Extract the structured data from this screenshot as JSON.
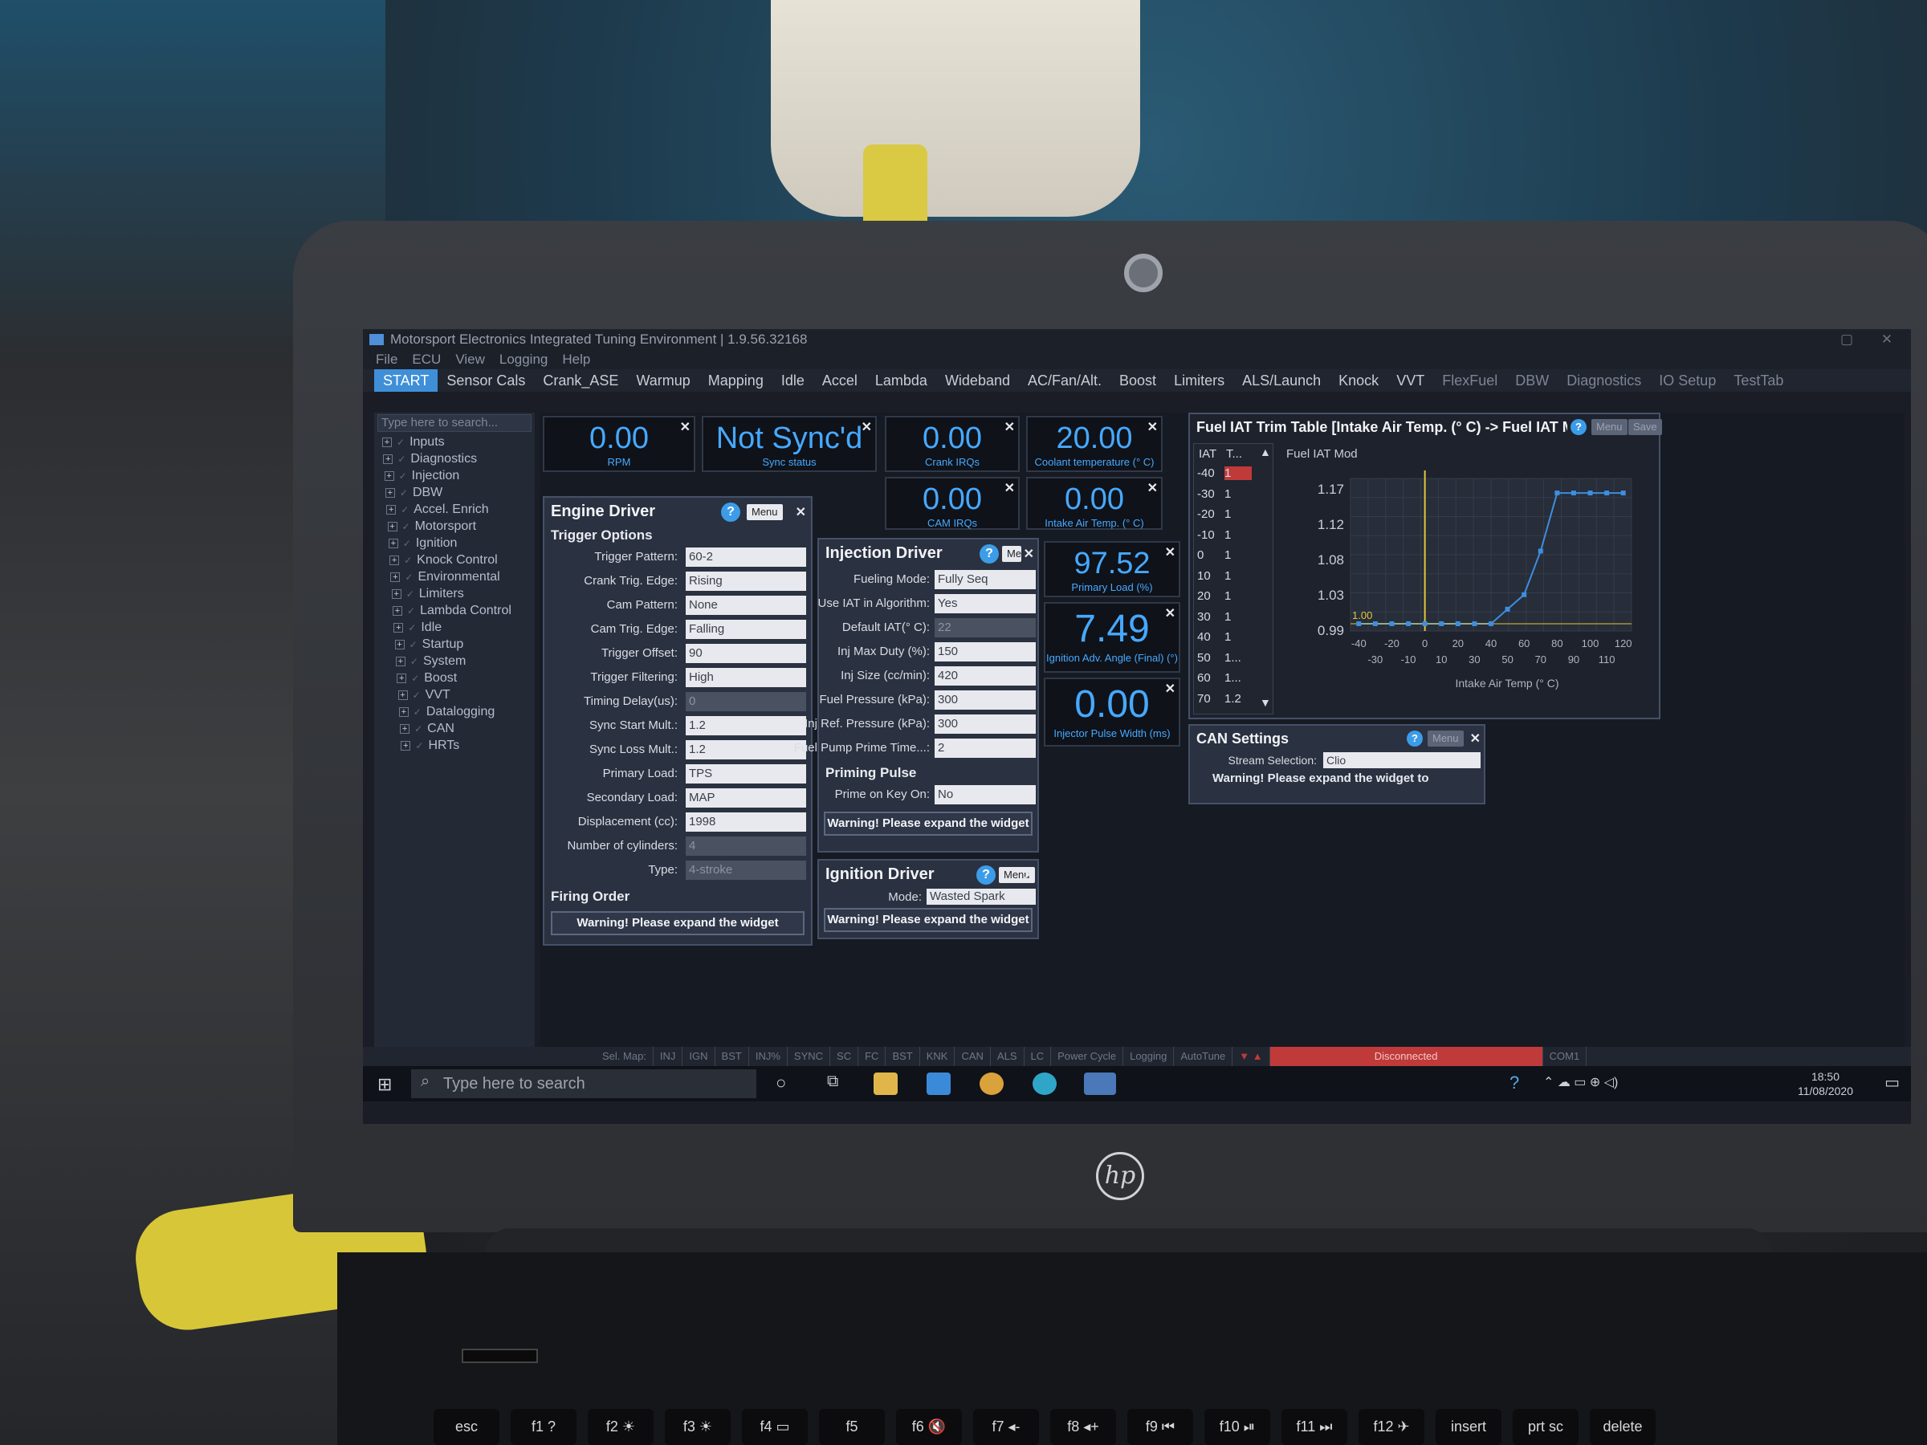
{
  "window": {
    "title": "Motorsport Electronics Integrated Tuning Environment | 1.9.56.32168"
  },
  "menu": [
    "File",
    "ECU",
    "View",
    "Logging",
    "Help"
  ],
  "nav_tabs": [
    "START",
    "Sensor Cals",
    "Crank_ASE",
    "Warmup",
    "Mapping",
    "Idle",
    "Accel",
    "Lambda",
    "Wideband",
    "AC/Fan/Alt.",
    "Boost",
    "Limiters",
    "ALS/Launch",
    "Knock",
    "VVT",
    "FlexFuel",
    "DBW",
    "Diagnostics",
    "IO Setup",
    "TestTab"
  ],
  "sidebar": {
    "search_placeholder": "Type here to search...",
    "items": [
      "Inputs",
      "Diagnostics",
      "Injection",
      "DBW",
      "Accel. Enrich",
      "Motorsport",
      "Ignition",
      "Knock Control",
      "Environmental",
      "Limiters",
      "Lambda Control",
      "Idle",
      "Startup",
      "System",
      "Boost",
      "VVT",
      "Datalogging",
      "CAN",
      "HRTs"
    ]
  },
  "gauges": {
    "rpm": {
      "value": "0.00",
      "label": "RPM"
    },
    "sync": {
      "value": "Not Sync'd",
      "label": "Sync status"
    },
    "crank_irqs": {
      "value": "0.00",
      "label": "Crank IRQs"
    },
    "coolant": {
      "value": "20.00",
      "label": "Coolant temperature (° C)"
    },
    "cam_irqs": {
      "value": "0.00",
      "label": "CAM IRQs"
    },
    "iat": {
      "value": "0.00",
      "label": "Intake Air Temp. (° C)"
    },
    "primary_load": {
      "value": "97.52",
      "label": "Primary Load (%)"
    },
    "ign_adv": {
      "value": "7.49",
      "label": "Ignition Adv. Angle (Final) (°)"
    },
    "inj_pw": {
      "value": "0.00",
      "label": "Injector Pulse Width (ms)"
    }
  },
  "engine_driver": {
    "title": "Engine Driver",
    "menu": "Menu",
    "section": "Trigger Options",
    "rows": [
      {
        "label": "Trigger Pattern:",
        "value": "60-2",
        "disabled": false
      },
      {
        "label": "Crank Trig. Edge:",
        "value": "Rising",
        "disabled": false
      },
      {
        "label": "Cam Pattern:",
        "value": "None",
        "disabled": false
      },
      {
        "label": "Cam Trig. Edge:",
        "value": "Falling",
        "disabled": false
      },
      {
        "label": "Trigger Offset:",
        "value": "90",
        "disabled": false
      },
      {
        "label": "Trigger Filtering:",
        "value": "High",
        "disabled": false
      },
      {
        "label": "Timing Delay(us):",
        "value": "0",
        "disabled": true
      },
      {
        "label": "Sync Start Mult.:",
        "value": "1.2",
        "disabled": false
      },
      {
        "label": "Sync Loss Mult.:",
        "value": "1.2",
        "disabled": false
      },
      {
        "label": "Primary Load:",
        "value": "TPS",
        "disabled": false
      },
      {
        "label": "Secondary Load:",
        "value": "MAP",
        "disabled": false
      },
      {
        "label": "Displacement (cc):",
        "value": "1998",
        "disabled": false
      },
      {
        "label": "Number of cylinders:",
        "value": "4",
        "disabled": true
      },
      {
        "label": "Type:",
        "value": "4-stroke",
        "disabled": true
      }
    ],
    "firing_order": "Firing Order",
    "warning": "Warning! Please expand the widget"
  },
  "injection_driver": {
    "title": "Injection Driver",
    "menu": "Menu",
    "rows": [
      {
        "label": "Fueling Mode:",
        "value": "Fully Seq",
        "disabled": false
      },
      {
        "label": "Use IAT in Algorithm:",
        "value": "Yes",
        "disabled": false
      },
      {
        "label": "Default IAT(° C):",
        "value": "22",
        "disabled": true
      },
      {
        "label": "Inj Max Duty (%):",
        "value": "150",
        "disabled": false
      },
      {
        "label": "Inj Size (cc/min):",
        "value": "420",
        "disabled": false
      },
      {
        "label": "Fuel Pressure (kPa):",
        "value": "300",
        "disabled": false
      },
      {
        "label": "Inj Ref. Pressure (kPa):",
        "value": "300",
        "disabled": false
      },
      {
        "label": "Fuel Pump Prime Time...:",
        "value": "2",
        "disabled": false
      }
    ],
    "priming": "Priming Pulse",
    "prime_label": "Prime on Key On:",
    "prime_value": "No",
    "warning": "Warning! Please expand the widget"
  },
  "ignition_driver": {
    "title": "Ignition Driver",
    "menu": "Menu",
    "mode_label": "Mode:",
    "mode_value": "Wasted Spark",
    "warning": "Warning! Please expand the widget"
  },
  "fuel_iat": {
    "title": "Fuel IAT Trim Table [Intake Air Temp. (° C) -> Fuel IAT M",
    "menu": "Menu",
    "save": "Save",
    "col1": "IAT",
    "col2": "T...",
    "rows": [
      {
        "iat": "-40",
        "t": "1"
      },
      {
        "iat": "-30",
        "t": "1"
      },
      {
        "iat": "-20",
        "t": "1"
      },
      {
        "iat": "-10",
        "t": "1"
      },
      {
        "iat": "0",
        "t": "1"
      },
      {
        "iat": "10",
        "t": "1"
      },
      {
        "iat": "20",
        "t": "1"
      },
      {
        "iat": "30",
        "t": "1"
      },
      {
        "iat": "40",
        "t": "1"
      },
      {
        "iat": "50",
        "t": "1..."
      },
      {
        "iat": "60",
        "t": "1..."
      },
      {
        "iat": "70",
        "t": "1.2"
      }
    ]
  },
  "chart_data": {
    "type": "line",
    "title": "Fuel IAT Mod",
    "xlabel": "Intake Air Temp (° C)",
    "ylabel": "",
    "x_ticks_top": [
      "-40",
      "-20",
      "0",
      "20",
      "40",
      "60",
      "80",
      "100",
      "120"
    ],
    "x_ticks_bottom": [
      "-30",
      "-10",
      "10",
      "30",
      "50",
      "70",
      "90",
      "110"
    ],
    "y_ticks": [
      "1.17",
      "1.12",
      "1.08",
      "1.03",
      "0.99"
    ],
    "current_value_label": "1.00",
    "xlim": [
      -45,
      125
    ],
    "ylim": [
      0.99,
      1.2
    ],
    "series": [
      {
        "x": [
          -40,
          -30,
          -20,
          -10,
          0,
          10,
          20,
          30,
          40,
          50,
          60,
          70,
          80,
          90,
          100,
          110,
          120
        ],
        "values": [
          1.0,
          1.0,
          1.0,
          1.0,
          1.0,
          1.0,
          1.0,
          1.0,
          1.0,
          1.02,
          1.04,
          1.1,
          1.18,
          1.18,
          1.18,
          1.18,
          1.18
        ]
      }
    ]
  },
  "can_settings": {
    "title": "CAN Settings",
    "menu": "Menu",
    "stream_label": "Stream Selection:",
    "stream_value": "Clio",
    "warning": "Warning! Please expand the widget to"
  },
  "statusbar": [
    "Sel. Map:",
    "INJ",
    "IGN",
    "BST",
    "INJ%",
    "SYNC",
    "SC",
    "FC",
    "BST",
    "KNK",
    "CAN",
    "ALS",
    "LC",
    "Power Cycle",
    "Logging",
    "AutoTune"
  ],
  "status_disconnected": "Disconnected",
  "status_port": "COM1",
  "taskbar": {
    "search_placeholder": "Type here to search",
    "time": "18:50",
    "date": "11/08/2020"
  },
  "keyboard_keys": [
    "esc",
    "f1 ?",
    "f2 ☀",
    "f3 ☀",
    "f4 ▭",
    "f5",
    "f6 🔇",
    "f7 ◂-",
    "f8 ◂+",
    "f9 ⏮",
    "f10 ⏯",
    "f11 ⏭",
    "f12 ✈",
    "insert",
    "prt sc",
    "delete"
  ],
  "brand": "hp",
  "colors": {
    "accent": "#46a9ff",
    "active_tab": "#3f8fd8",
    "disconnected": "#c03a3a"
  }
}
